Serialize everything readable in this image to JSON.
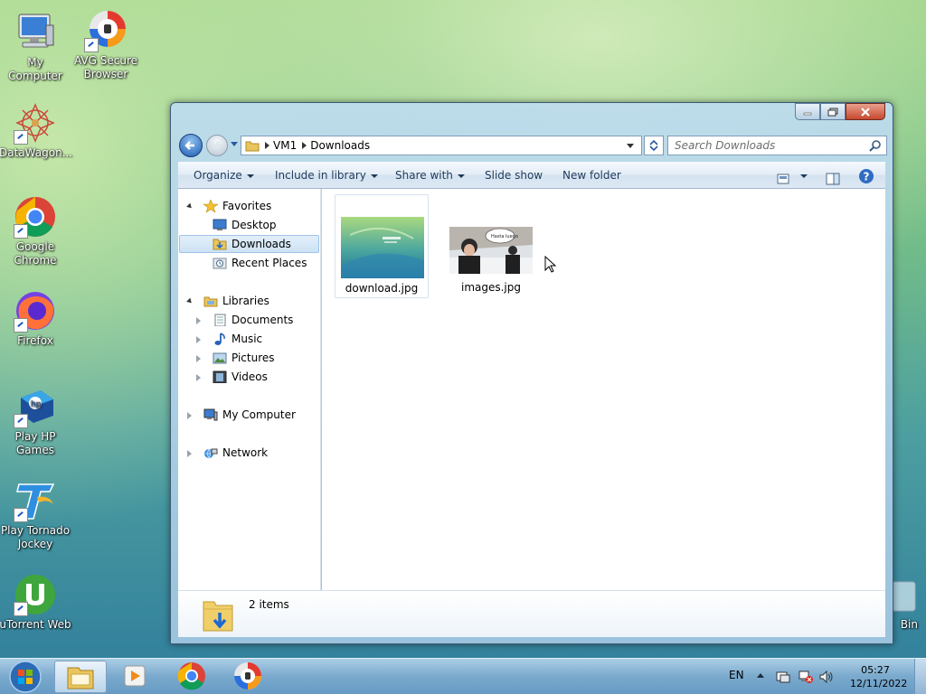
{
  "desktop": {
    "icons": [
      {
        "label": "My Computer",
        "icon": "computer-icon"
      },
      {
        "label": "AVG Secure Browser",
        "icon": "avg-browser-icon"
      },
      {
        "label": "DataWagon...",
        "icon": "datawagon-icon"
      },
      {
        "label": "Google Chrome",
        "icon": "chrome-icon"
      },
      {
        "label": "Firefox",
        "icon": "firefox-icon"
      },
      {
        "label": "Play HP Games",
        "icon": "hp-games-icon"
      },
      {
        "label": "Play Tornado Jockey",
        "icon": "tornado-jockey-icon"
      },
      {
        "label": "uTorrent Web",
        "icon": "utorrent-icon"
      },
      {
        "label": "Bin",
        "icon": "recycle-bin-icon"
      }
    ]
  },
  "explorer": {
    "breadcrumb": [
      "VM1",
      "Downloads"
    ],
    "search_placeholder": "Search Downloads",
    "toolbar": {
      "organize": "Organize",
      "include_in_library": "Include in library",
      "share_with": "Share with",
      "slide_show": "Slide show",
      "new_folder": "New folder"
    },
    "nav": {
      "favorites": "Favorites",
      "desktop": "Desktop",
      "downloads": "Downloads",
      "recent_places": "Recent Places",
      "libraries": "Libraries",
      "documents": "Documents",
      "music": "Music",
      "pictures": "Pictures",
      "videos": "Videos",
      "my_computer": "My Computer",
      "network": "Network"
    },
    "selected_nav": "Downloads",
    "files": [
      {
        "name": "download.jpg"
      },
      {
        "name": "images.jpg",
        "caption": "Hasta luego"
      }
    ],
    "status": "2 items"
  },
  "taskbar": {
    "language": "EN",
    "time": "05:27",
    "date": "12/11/2022"
  },
  "colors": {
    "accent": "#1d5bb0",
    "selection": "#cde2f5",
    "command_text": "#1e395b"
  }
}
